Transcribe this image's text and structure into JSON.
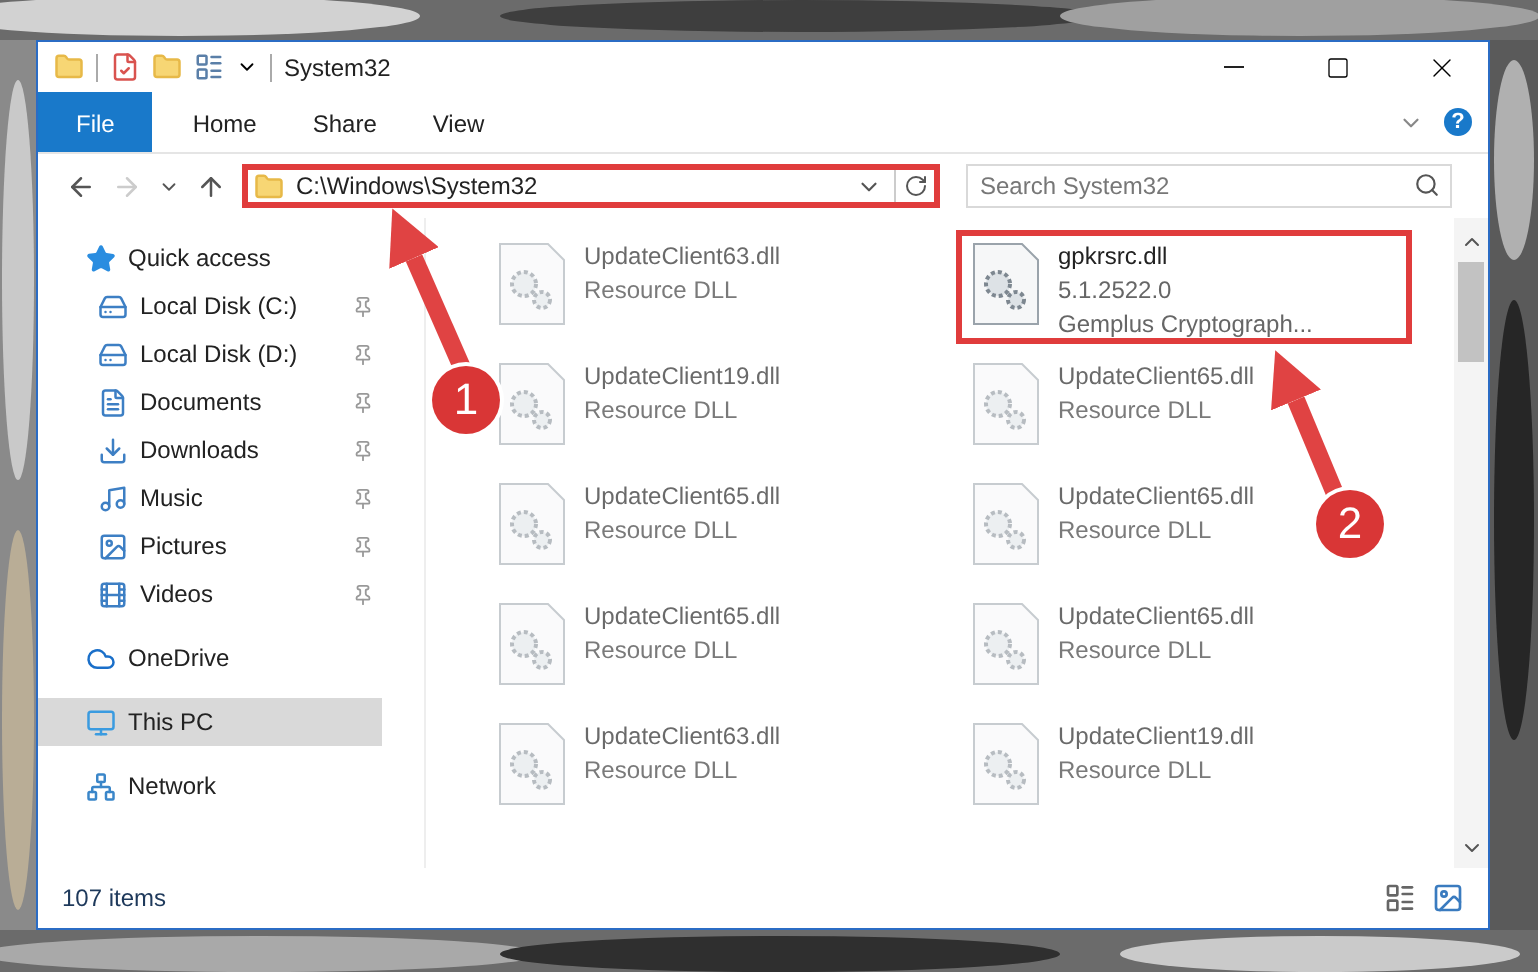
{
  "window": {
    "title": "System32"
  },
  "ribbon": {
    "tabs": [
      {
        "label": "File",
        "kind": "file",
        "selected": false
      },
      {
        "label": "Home",
        "kind": "tab",
        "selected": false
      },
      {
        "label": "Share",
        "kind": "tab",
        "selected": false
      },
      {
        "label": "View",
        "kind": "tab",
        "selected": false
      }
    ],
    "help": "?"
  },
  "navigation": {
    "back": {
      "disabled": false
    },
    "forward": {
      "disabled": true
    }
  },
  "address_bar": {
    "path": "C:\\Windows\\System32",
    "highlighted": true
  },
  "search": {
    "placeholder": "Search System32"
  },
  "sidebar": {
    "items": [
      {
        "label": "Quick access",
        "selected": false,
        "children": [
          {
            "label": "Local Disk (C:)",
            "pinned": true,
            "selected": false
          },
          {
            "label": "Local Disk (D:)",
            "pinned": true,
            "selected": false
          },
          {
            "label": "Documents",
            "pinned": true,
            "selected": false
          },
          {
            "label": "Downloads",
            "pinned": true,
            "selected": false
          },
          {
            "label": "Music",
            "pinned": true,
            "selected": false
          },
          {
            "label": "Pictures",
            "pinned": true,
            "selected": false
          },
          {
            "label": "Videos",
            "pinned": true,
            "selected": false
          }
        ]
      },
      {
        "label": "OneDrive",
        "selected": false
      },
      {
        "label": "This PC",
        "selected": true
      },
      {
        "label": "Network",
        "selected": false
      }
    ]
  },
  "files": [
    {
      "name": "UpdateClient63.dll",
      "details": [
        "Resource DLL"
      ],
      "blurred": true,
      "highlighted": false
    },
    {
      "name": "gpkrsrc.dll",
      "details": [
        "5.1.2522.0",
        "Gemplus Cryptograph..."
      ],
      "blurred": false,
      "highlighted": true
    },
    {
      "name": "UpdateClient19.dll",
      "details": [
        "Resource DLL"
      ],
      "blurred": true,
      "highlighted": false
    },
    {
      "name": "UpdateClient65.dll",
      "details": [
        "Resource DLL"
      ],
      "blurred": true,
      "highlighted": false
    },
    {
      "name": "UpdateClient65.dll",
      "details": [
        "Resource DLL"
      ],
      "blurred": true,
      "highlighted": false
    },
    {
      "name": "UpdateClient65.dll",
      "details": [
        "Resource DLL"
      ],
      "blurred": true,
      "highlighted": false
    },
    {
      "name": "UpdateClient65.dll",
      "details": [
        "Resource DLL"
      ],
      "blurred": true,
      "highlighted": false
    },
    {
      "name": "UpdateClient65.dll",
      "details": [
        "Resource DLL"
      ],
      "blurred": true,
      "highlighted": false
    },
    {
      "name": "UpdateClient63.dll",
      "details": [
        "Resource DLL"
      ],
      "blurred": true,
      "highlighted": false
    },
    {
      "name": "UpdateClient19.dll",
      "details": [
        "Resource DLL"
      ],
      "blurred": true,
      "highlighted": false
    }
  ],
  "status_bar": {
    "item_count": "107 items"
  },
  "callouts": [
    {
      "label": "1"
    },
    {
      "label": "2"
    }
  ]
}
